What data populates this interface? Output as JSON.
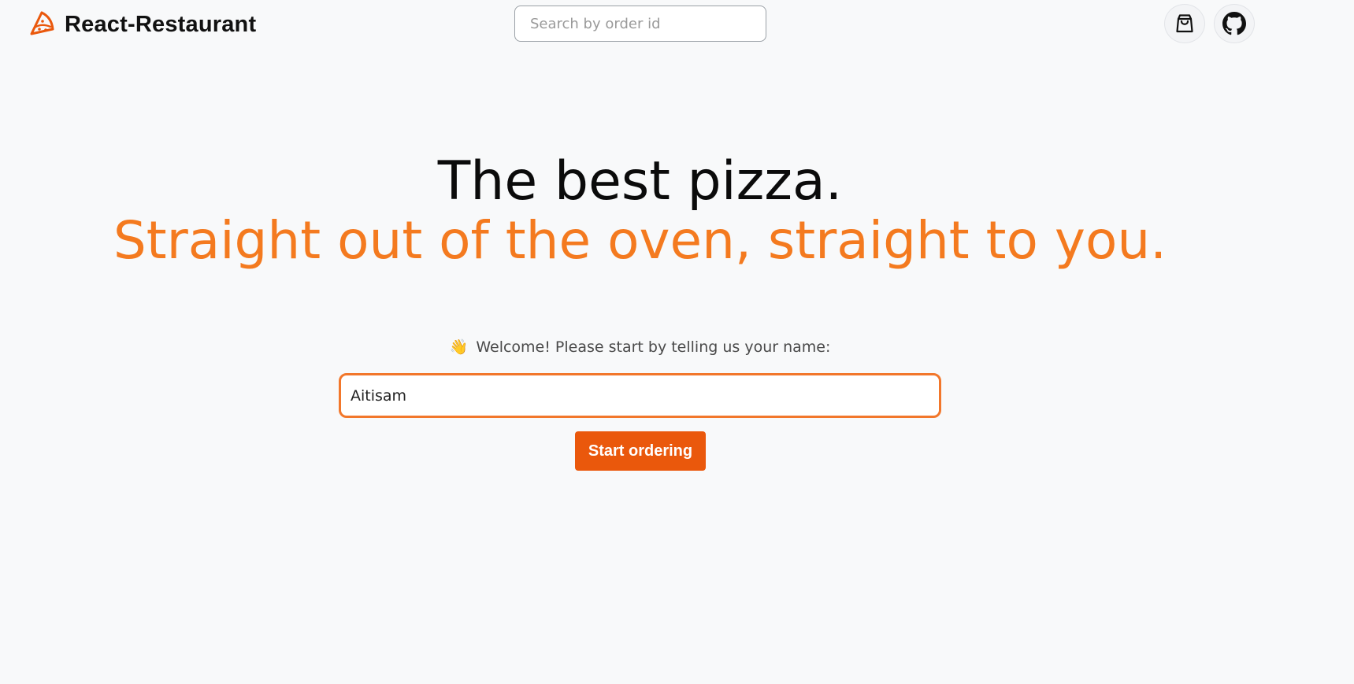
{
  "header": {
    "brand_name": "React-Restaurant",
    "brand_icon": "pizza-slice-icon",
    "search": {
      "placeholder": "Search by order id",
      "value": ""
    },
    "cart_icon": "shopping-bag-icon",
    "github_icon": "github-icon"
  },
  "hero": {
    "title": "The best pizza.",
    "subtitle": "Straight out of the oven, straight to you."
  },
  "form": {
    "welcome_emoji": "👋",
    "welcome_text": "Welcome! Please start by telling us your name:",
    "name_value": "Aitisam",
    "submit_label": "Start ordering"
  },
  "colors": {
    "accent": "#ea580c",
    "subtitle": "#f47a1f",
    "background": "#f8f9fa"
  }
}
